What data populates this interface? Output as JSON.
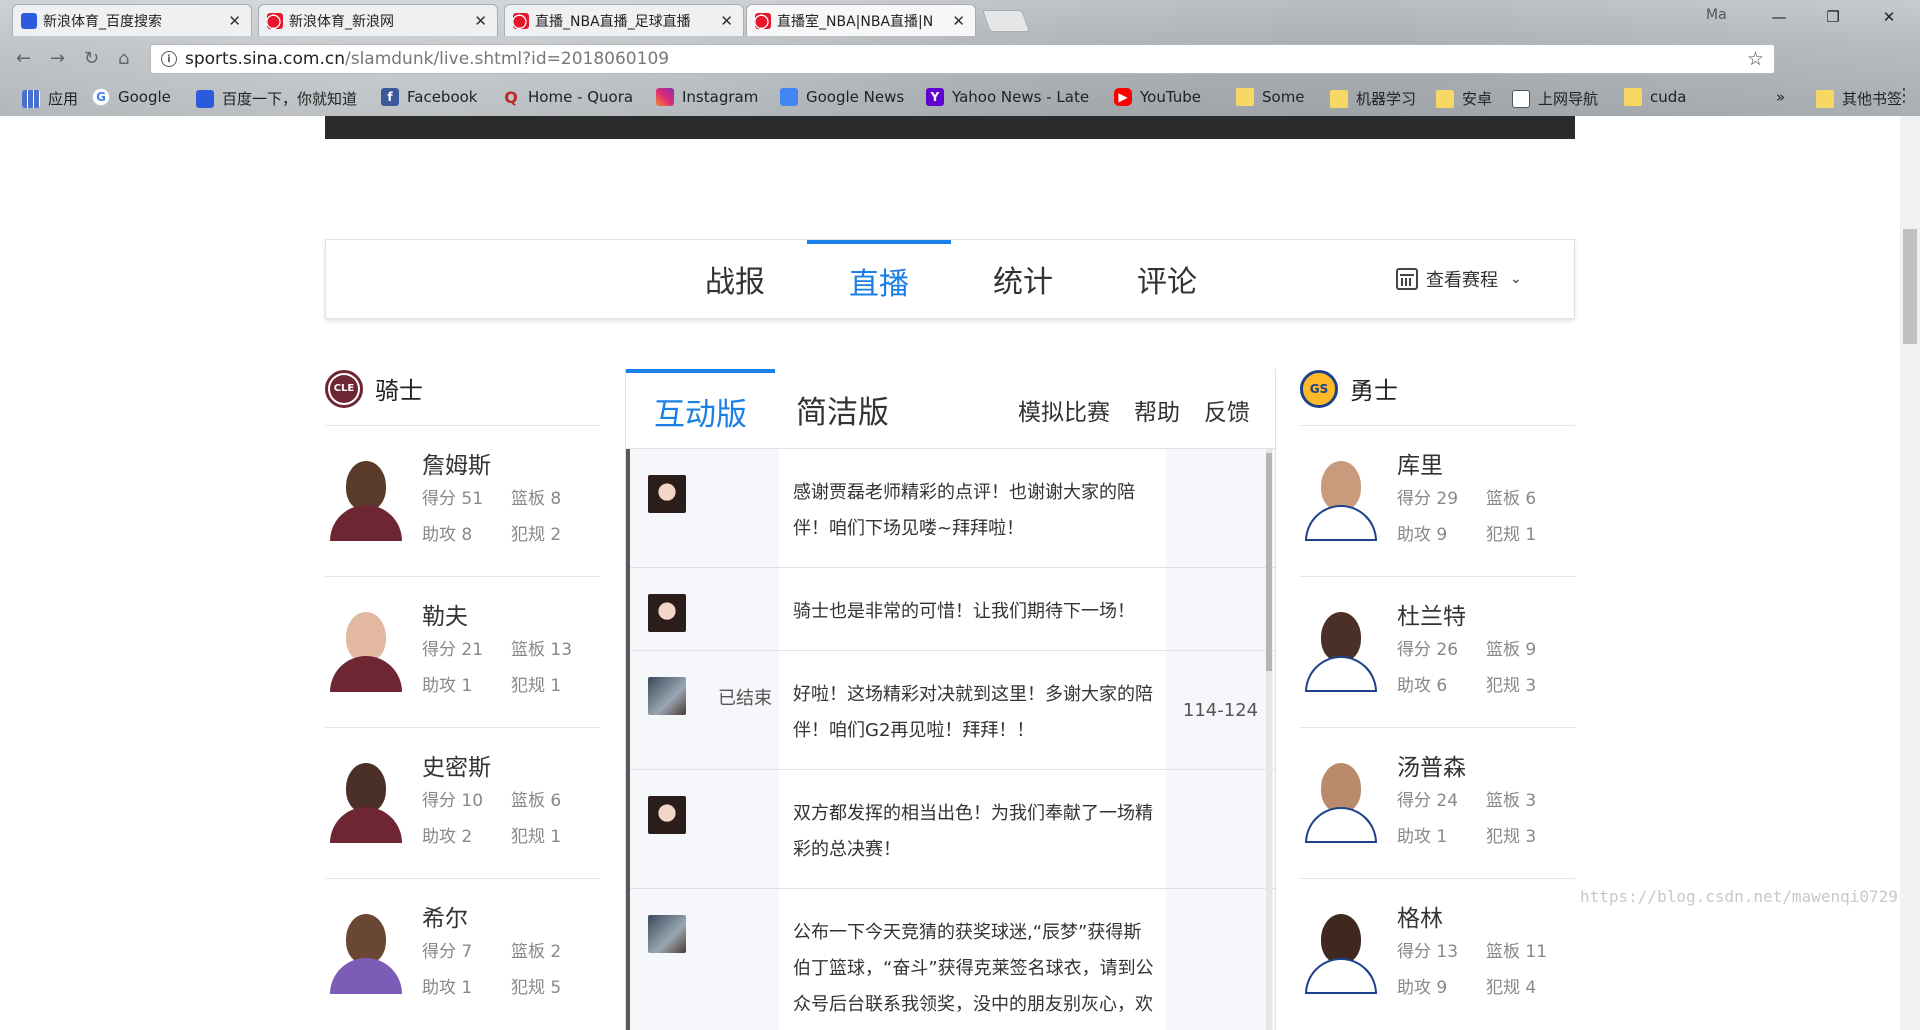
{
  "browser": {
    "tabs": [
      {
        "title": "新浪体育_百度搜索",
        "favicon": "baidu-icon"
      },
      {
        "title": "新浪体育_新浪网",
        "favicon": "sina-weibo-icon"
      },
      {
        "title": "直播_NBA直播_足球直播",
        "favicon": "sina-weibo-icon"
      },
      {
        "title": "直播室_NBA|NBA直播|N",
        "favicon": "sina-weibo-icon"
      }
    ],
    "profile": "Ma",
    "url_host": "sports.sina.com.cn",
    "url_path": "/slamdunk/live.shtml?id=2018060109",
    "bookmarks": [
      {
        "label": "应用",
        "icon": "apps-grid-icon"
      },
      {
        "label": "Google",
        "icon": "google-icon"
      },
      {
        "label": "百度一下，你就知道",
        "icon": "baidu-icon"
      },
      {
        "label": "Facebook",
        "icon": "facebook-icon"
      },
      {
        "label": "Home - Quora",
        "icon": "quora-icon"
      },
      {
        "label": "Instagram",
        "icon": "instagram-icon"
      },
      {
        "label": "Google News",
        "icon": "google-news-icon"
      },
      {
        "label": "Yahoo News - Late",
        "icon": "yahoo-icon"
      },
      {
        "label": "YouTube",
        "icon": "youtube-icon"
      },
      {
        "label": "Some",
        "icon": "folder-icon"
      },
      {
        "label": "机器学习",
        "icon": "folder-icon"
      },
      {
        "label": "安卓",
        "icon": "folder-icon"
      },
      {
        "label": "上网导航",
        "icon": "document-icon"
      },
      {
        "label": "cuda",
        "icon": "folder-icon"
      }
    ],
    "more_bookmarks": "»",
    "other_bookmarks": "其他书签"
  },
  "nav": {
    "tabs": [
      "战报",
      "直播",
      "统计",
      "评论"
    ],
    "active": "直播",
    "schedule": "查看赛程"
  },
  "home_team": {
    "name": "骑士",
    "logo_text": "CLE",
    "players": [
      {
        "name": "詹姆斯",
        "points": "得分 51",
        "rebounds": "篮板 8",
        "assists": "助攻 8",
        "fouls": "犯规 2"
      },
      {
        "name": "勒夫",
        "points": "得分 21",
        "rebounds": "篮板 13",
        "assists": "助攻 1",
        "fouls": "犯规 1"
      },
      {
        "name": "史密斯",
        "points": "得分 10",
        "rebounds": "篮板 6",
        "assists": "助攻 2",
        "fouls": "犯规 1"
      },
      {
        "name": "希尔",
        "points": "得分 7",
        "rebounds": "篮板 2",
        "assists": "助攻 1",
        "fouls": "犯规 5"
      }
    ]
  },
  "away_team": {
    "name": "勇士",
    "logo_text": "GS",
    "players": [
      {
        "name": "库里",
        "points": "得分 29",
        "rebounds": "篮板 6",
        "assists": "助攻 9",
        "fouls": "犯规 1"
      },
      {
        "name": "杜兰特",
        "points": "得分 26",
        "rebounds": "篮板 9",
        "assists": "助攻 6",
        "fouls": "犯规 3"
      },
      {
        "name": "汤普森",
        "points": "得分 24",
        "rebounds": "篮板 3",
        "assists": "助攻 1",
        "fouls": "犯规 3"
      },
      {
        "name": "格林",
        "points": "得分 13",
        "rebounds": "篮板 11",
        "assists": "助攻 9",
        "fouls": "犯规 4"
      }
    ]
  },
  "live": {
    "tabs": [
      "互动版",
      "简洁版"
    ],
    "active_tab": "互动版",
    "actions": [
      "模拟比赛",
      "帮助",
      "反馈"
    ],
    "messages": [
      {
        "avatar": "girl",
        "status": "",
        "text": "感谢贾磊老师精彩的点评！也谢谢大家的陪伴！咱们下场见喽~拜拜啦！",
        "score": ""
      },
      {
        "avatar": "girl",
        "status": "",
        "text": "骑士也是非常的可惜！让我们期待下一场！",
        "score": ""
      },
      {
        "avatar": "man",
        "status": "已结束",
        "text": "好啦！这场精彩对决就到这里！多谢大家的陪伴！咱们G2再见啦！拜拜！！",
        "score": "114-124"
      },
      {
        "avatar": "girl",
        "status": "",
        "text": "双方都发挥的相当出色！为我们奉献了一场精彩的总决赛！",
        "score": ""
      },
      {
        "avatar": "man",
        "status": "",
        "text": "公布一下今天竞猜的获奖球迷,“辰梦”获得斯伯丁篮球，“奋斗”获得克莱签名球衣，请到公众号后台联系我领奖，没中的朋友别灰心，欢迎大家扫描二维码到我的公众号交",
        "score": ""
      }
    ]
  },
  "watermark": "https://blog.csdn.net/mawenqi0729",
  "colors": {
    "accent": "#1a7fe6",
    "cle": "#6f2633",
    "gs": "#1d428a"
  }
}
